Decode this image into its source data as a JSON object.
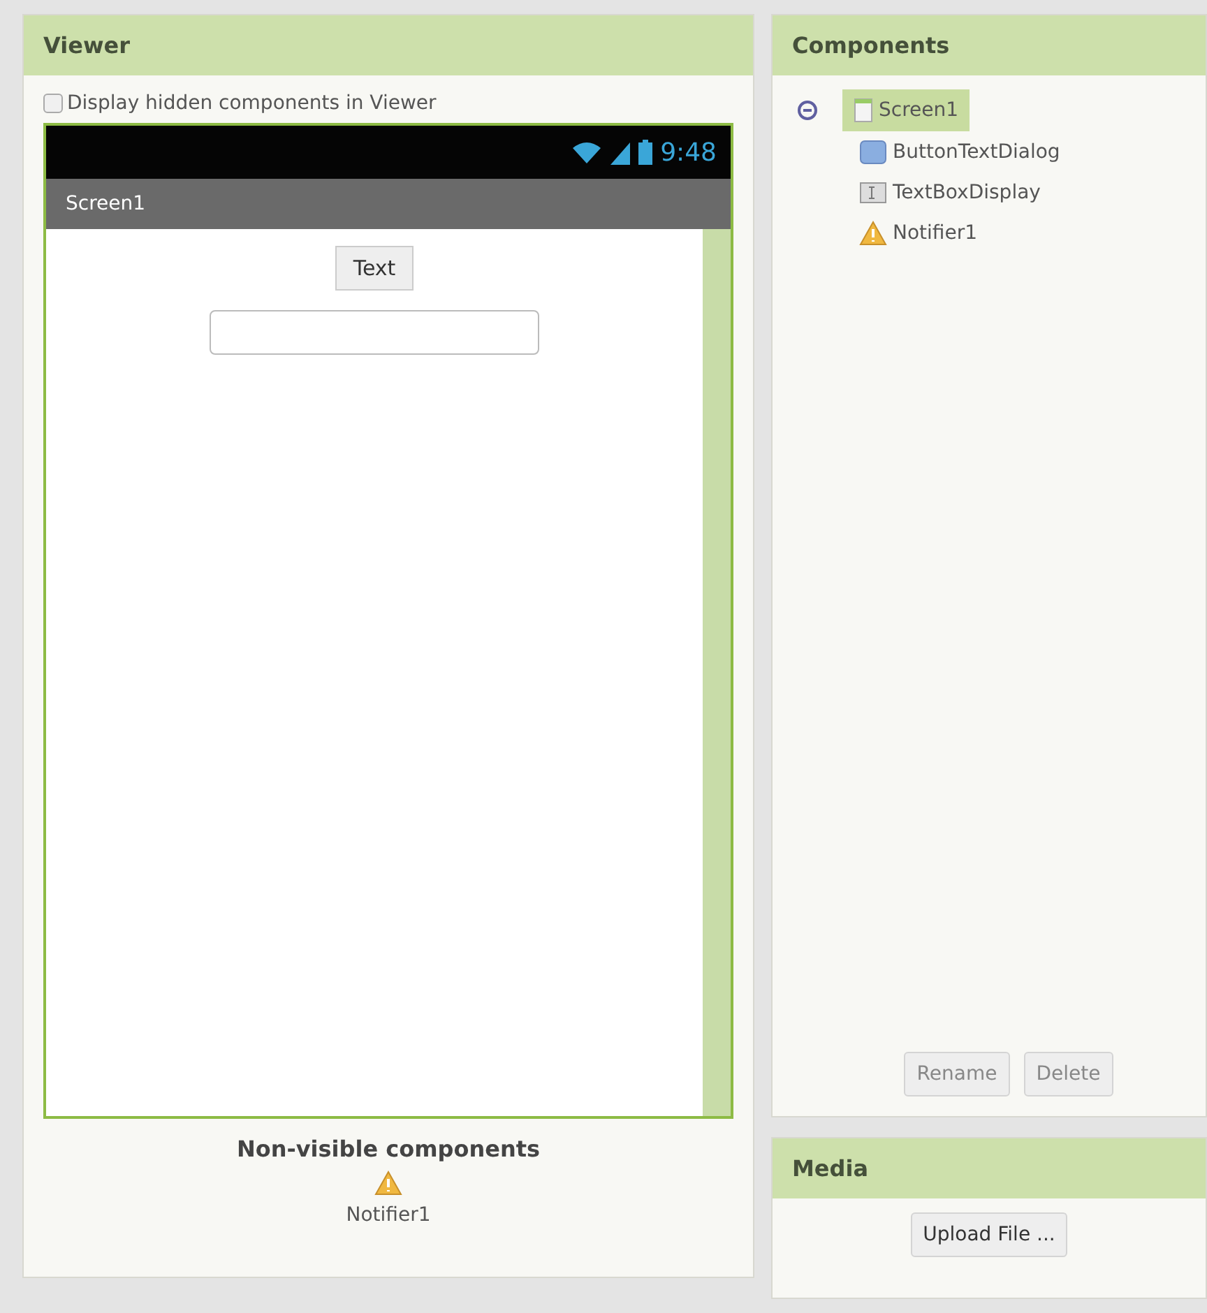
{
  "viewer": {
    "title": "Viewer",
    "hidden_checkbox": {
      "label": "Display hidden components in Viewer",
      "checked": false
    },
    "phone": {
      "time": "9:48",
      "screen_title": "Screen1",
      "button": "Text"
    },
    "non_visible": {
      "title": "Non-visible components",
      "items": [
        {
          "kind": "notifier",
          "label": "Notifier1"
        }
      ]
    }
  },
  "components": {
    "title": "Components",
    "tree": [
      {
        "kind": "screen",
        "label": "Screen1",
        "selected": true,
        "expanded": true,
        "children": [
          {
            "kind": "button",
            "label": "ButtonTextDialog",
            "selected": false
          },
          {
            "kind": "textbox",
            "label": "TextBoxDisplay",
            "selected": false
          },
          {
            "kind": "notifier",
            "label": "Notifier1",
            "selected": false
          }
        ]
      }
    ],
    "buttons": [
      {
        "label": "Rename",
        "disabled": true
      },
      {
        "label": "Delete",
        "disabled": true
      }
    ]
  },
  "media": {
    "title": "Media",
    "button": "Upload File ..."
  }
}
